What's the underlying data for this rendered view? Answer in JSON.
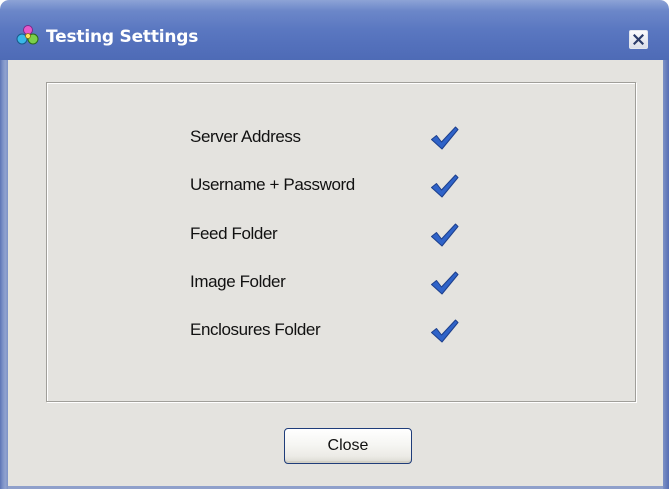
{
  "window": {
    "title": "Testing Settings",
    "title_icon": "app-icon",
    "close_icon": "close-icon"
  },
  "checks": [
    {
      "label": "Server Address",
      "status": "ok",
      "icon": "checkmark-icon"
    },
    {
      "label": "Username + Password",
      "status": "ok",
      "icon": "checkmark-icon"
    },
    {
      "label": "Feed Folder",
      "status": "ok",
      "icon": "checkmark-icon"
    },
    {
      "label": "Image Folder",
      "status": "ok",
      "icon": "checkmark-icon"
    },
    {
      "label": "Enclosures Folder",
      "status": "ok",
      "icon": "checkmark-icon"
    }
  ],
  "buttons": {
    "close_label": "Close"
  },
  "colors": {
    "titlebar": "#5b78c1",
    "check": "#2f63c8",
    "dialog_background": "#e4e3df"
  }
}
